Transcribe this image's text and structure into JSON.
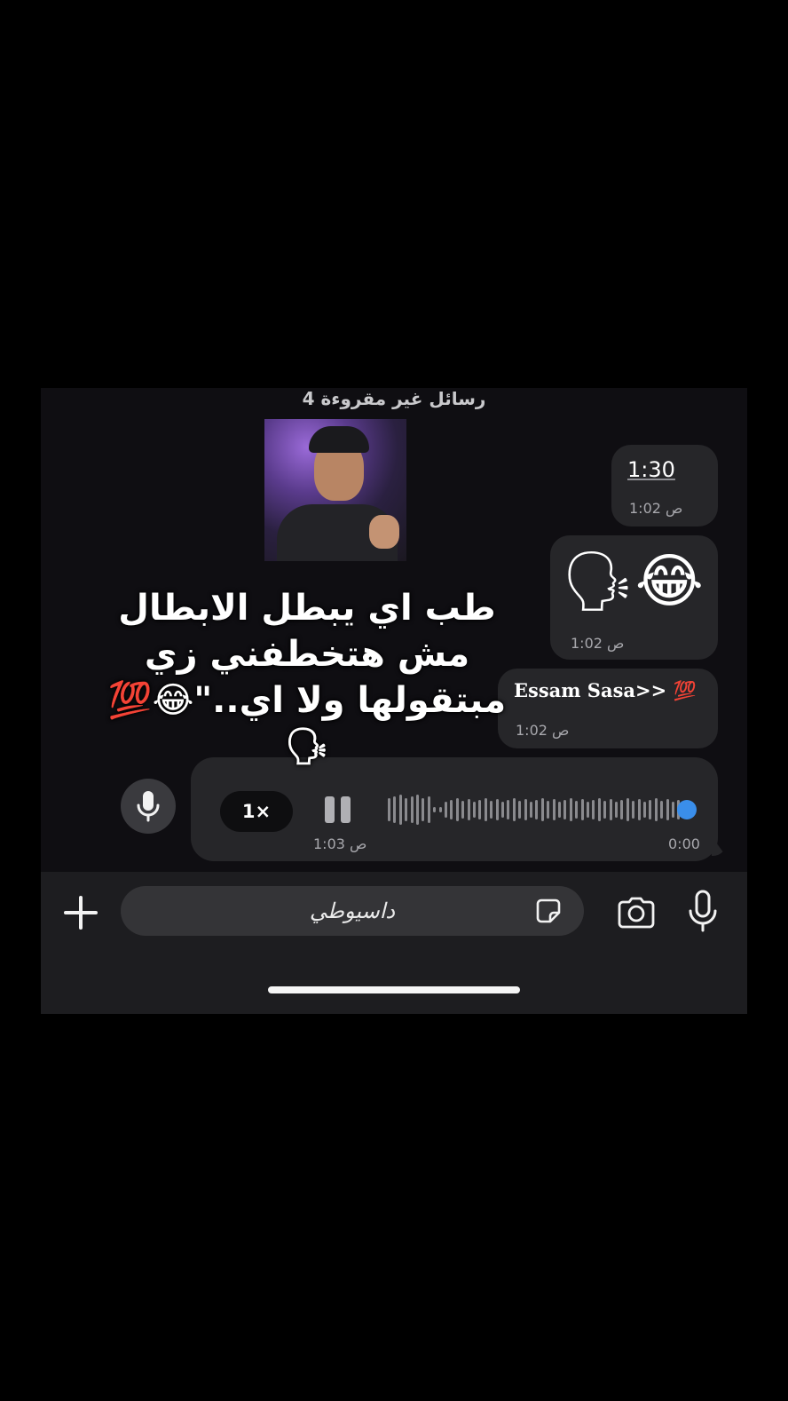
{
  "chat": {
    "unread_banner": "4 رسائل غير مقروءة",
    "messages": [
      {
        "type": "text",
        "text": "1:30",
        "time": "1:02 ص"
      },
      {
        "type": "emoji",
        "text": "🗣😂",
        "time": "1:02 ص"
      },
      {
        "type": "text",
        "text": "Essam Sasa>> 💯",
        "time": "1:02 ص"
      }
    ],
    "voice_note": {
      "speed": "1×",
      "played_time": "1:03 ص",
      "duration": "0:00",
      "progress": 1.0
    }
  },
  "overlay": {
    "caption": "طب اي يبطل الابطال مش هتخطفني زي مبتقولها ولا اي..\"😂💯🗣"
  },
  "input_bar": {
    "field_text": "داسيوطي"
  },
  "colors": {
    "background": "#000000",
    "chat_background": "#0f0e12",
    "bubble": "#262629",
    "accent": "#3a8eea"
  },
  "icons": [
    "plus-icon",
    "sticker-icon",
    "camera-icon",
    "microphone-icon",
    "pause-icon"
  ]
}
